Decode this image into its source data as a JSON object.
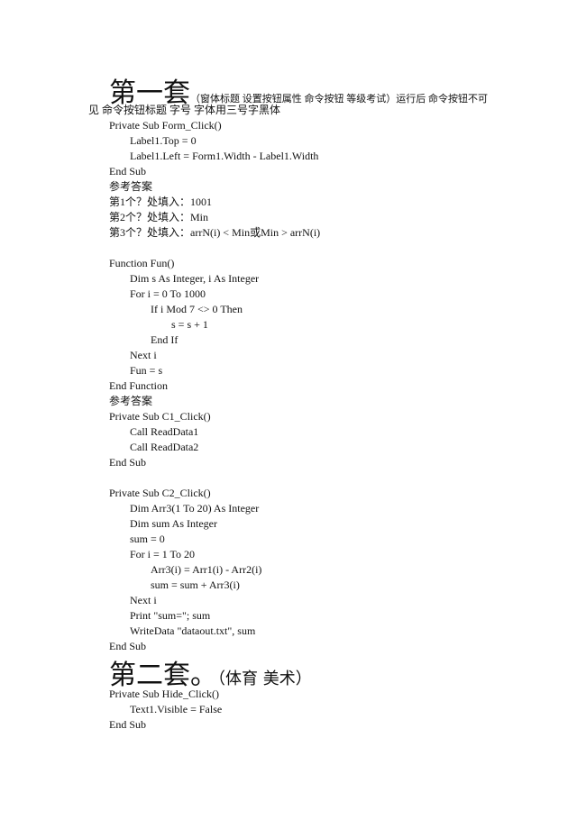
{
  "section1": {
    "heading": "第一套",
    "heading_note": "（窗体标题  设置按钮属性  命令按钮  等级考试）运行后  命令按钮不可",
    "heading_cont": "见  命令按钮标题  字号  字体用三号字黑体"
  },
  "lines": [
    {
      "indent": 0,
      "text": "Private Sub Form_Click()"
    },
    {
      "indent": 1,
      "text": "Label1.Top = 0"
    },
    {
      "indent": 1,
      "text": "Label1.Left = Form1.Width - Label1.Width"
    },
    {
      "indent": 0,
      "text": "End Sub"
    },
    {
      "indent": 0,
      "text": "参考答案"
    },
    {
      "indent": 0,
      "text": "第1个？处填入：1001"
    },
    {
      "indent": 0,
      "text": "第2个？处填入：Min"
    },
    {
      "indent": 0,
      "text": "第3个？处填入：arrN(i) < Min或Min > arrN(i)"
    },
    {
      "indent": 0,
      "text": ""
    },
    {
      "indent": 0,
      "text": "Function Fun()"
    },
    {
      "indent": 1,
      "text": "Dim s As Integer, i As Integer"
    },
    {
      "indent": 1,
      "text": "For i = 0 To 1000"
    },
    {
      "indent": 2,
      "text": "If i Mod 7 <> 0 Then"
    },
    {
      "indent": 3,
      "text": "s = s + 1"
    },
    {
      "indent": 2,
      "text": "End If"
    },
    {
      "indent": 1,
      "text": "Next i"
    },
    {
      "indent": 1,
      "text": "Fun = s"
    },
    {
      "indent": 0,
      "text": "End Function"
    },
    {
      "indent": 0,
      "text": "参考答案"
    },
    {
      "indent": 0,
      "text": "Private Sub C1_Click()"
    },
    {
      "indent": 1,
      "text": "Call ReadData1"
    },
    {
      "indent": 1,
      "text": "Call ReadData2"
    },
    {
      "indent": 0,
      "text": "End Sub"
    },
    {
      "indent": 0,
      "text": ""
    },
    {
      "indent": 0,
      "text": "Private Sub C2_Click()"
    },
    {
      "indent": 1,
      "text": "Dim Arr3(1 To 20) As Integer"
    },
    {
      "indent": 1,
      "text": "Dim sum As Integer"
    },
    {
      "indent": 1,
      "text": "sum = 0"
    },
    {
      "indent": 1,
      "text": "For i = 1 To 20"
    },
    {
      "indent": 2,
      "text": "Arr3(i) = Arr1(i) - Arr2(i)"
    },
    {
      "indent": 2,
      "text": "sum = sum + Arr3(i)"
    },
    {
      "indent": 1,
      "text": "Next i"
    },
    {
      "indent": 1,
      "text": "Print \"sum=\"; sum"
    },
    {
      "indent": 1,
      "text": "WriteData \"dataout.txt\", sum"
    },
    {
      "indent": 0,
      "text": "End Sub"
    }
  ],
  "section2": {
    "heading": "第二套。",
    "heading_note": "（体育  美术）"
  },
  "lines2": [
    {
      "indent": 0,
      "text": "Private Sub Hide_Click()"
    },
    {
      "indent": 1,
      "text": "Text1.Visible = False"
    },
    {
      "indent": 0,
      "text": "End Sub"
    }
  ]
}
